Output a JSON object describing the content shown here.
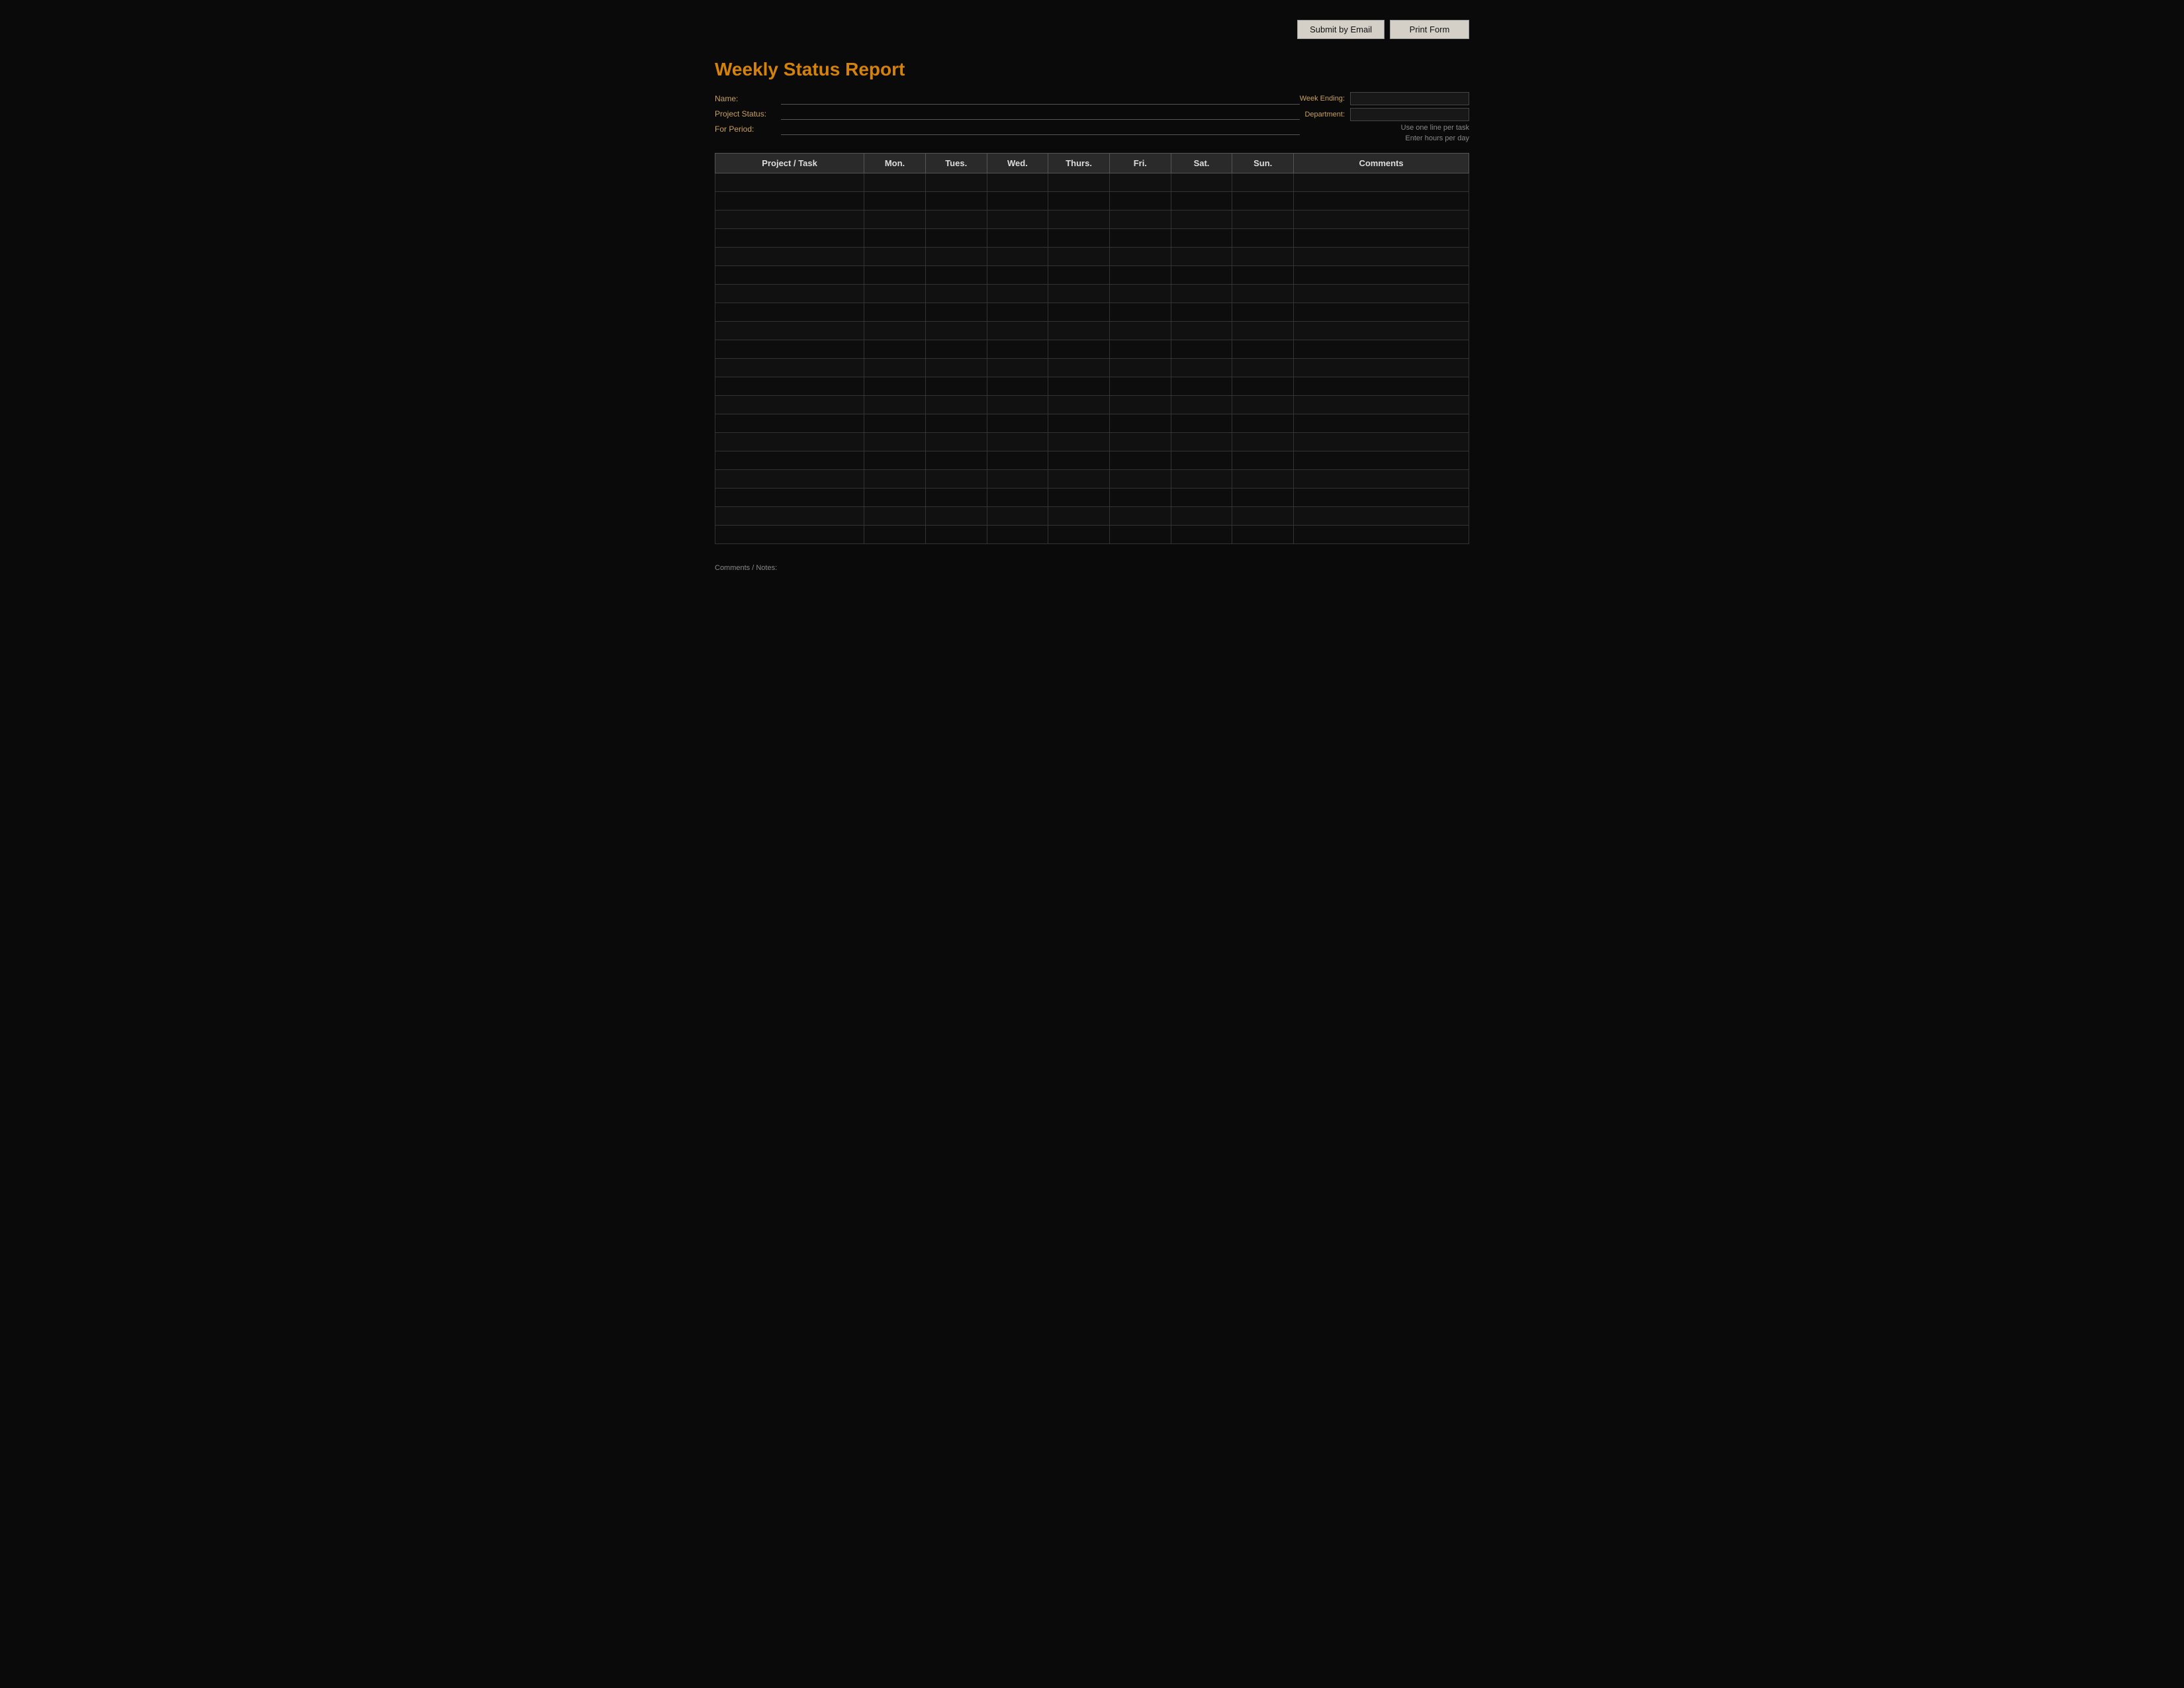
{
  "toolbar": {
    "submit_email_label": "Submit by Email",
    "print_form_label": "Print Form"
  },
  "report": {
    "title": "Weekly Status Report",
    "fields": {
      "name_label": "Name:",
      "name_value": "",
      "project_status_label": "Project Status:",
      "project_status_value": "",
      "for_period_label": "For Period:",
      "for_period_value": ""
    },
    "right_fields": {
      "week_ending_label": "Week Ending:",
      "week_ending_value": "",
      "department_label": "Department:",
      "department_value": "",
      "info_line1": "Use one line per task",
      "info_line2": "Enter hours per day"
    }
  },
  "table": {
    "headers": [
      "Project / Task",
      "Mon.",
      "Tues.",
      "Wed.",
      "Thurs.",
      "Fri.",
      "Sat.",
      "Sun.",
      "Comments"
    ],
    "rows": 20
  },
  "footer": {
    "note_label": "Comments / Notes:"
  }
}
